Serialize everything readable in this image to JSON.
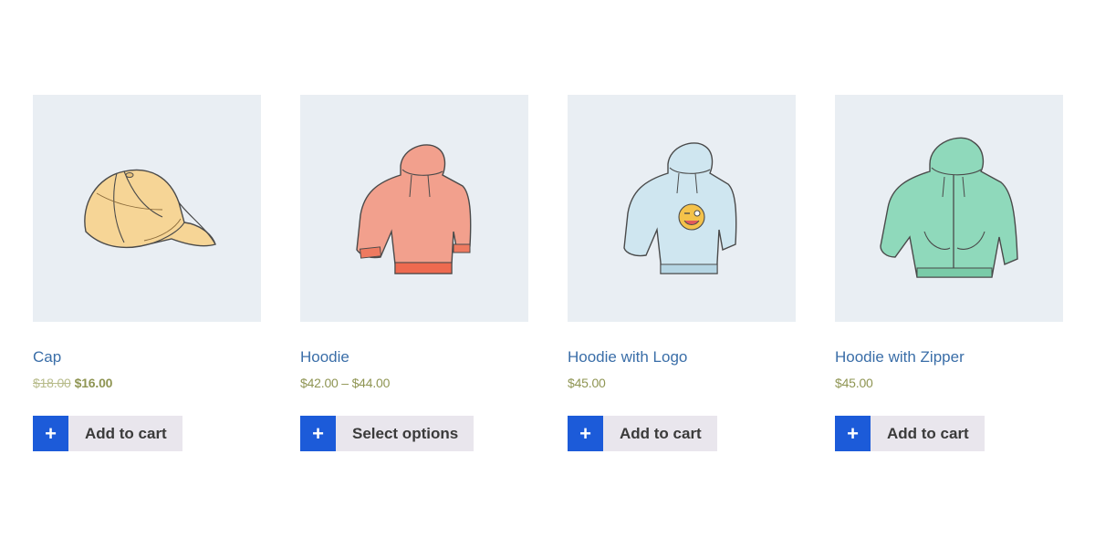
{
  "products": [
    {
      "name": "Cap",
      "image_icon": "cap-icon",
      "price": {
        "regular": "$18.00",
        "sale": "$16.00"
      },
      "button": {
        "icon": "+",
        "label": "Add to cart"
      }
    },
    {
      "name": "Hoodie",
      "image_icon": "hoodie-icon",
      "price": {
        "range": "$42.00 – $44.00"
      },
      "button": {
        "icon": "+",
        "label": "Select options"
      }
    },
    {
      "name": "Hoodie with Logo",
      "image_icon": "hoodie-logo-icon",
      "price": {
        "current": "$45.00"
      },
      "button": {
        "icon": "+",
        "label": "Add to cart"
      }
    },
    {
      "name": "Hoodie with Zipper",
      "image_icon": "hoodie-zipper-icon",
      "price": {
        "current": "$45.00"
      },
      "button": {
        "icon": "+",
        "label": "Add to cart"
      }
    }
  ],
  "colors": {
    "image_background": "#e9eef3",
    "title_link": "#3a6ea8",
    "price": "#8f9553",
    "button_accent": "#1c5bd9",
    "button_background": "#e9e6ed",
    "cap": "#f6d596",
    "hoodie": "#f2a08d",
    "hoodie_logo": "#cfe6f0",
    "hoodie_zipper": "#8fd9bb"
  }
}
